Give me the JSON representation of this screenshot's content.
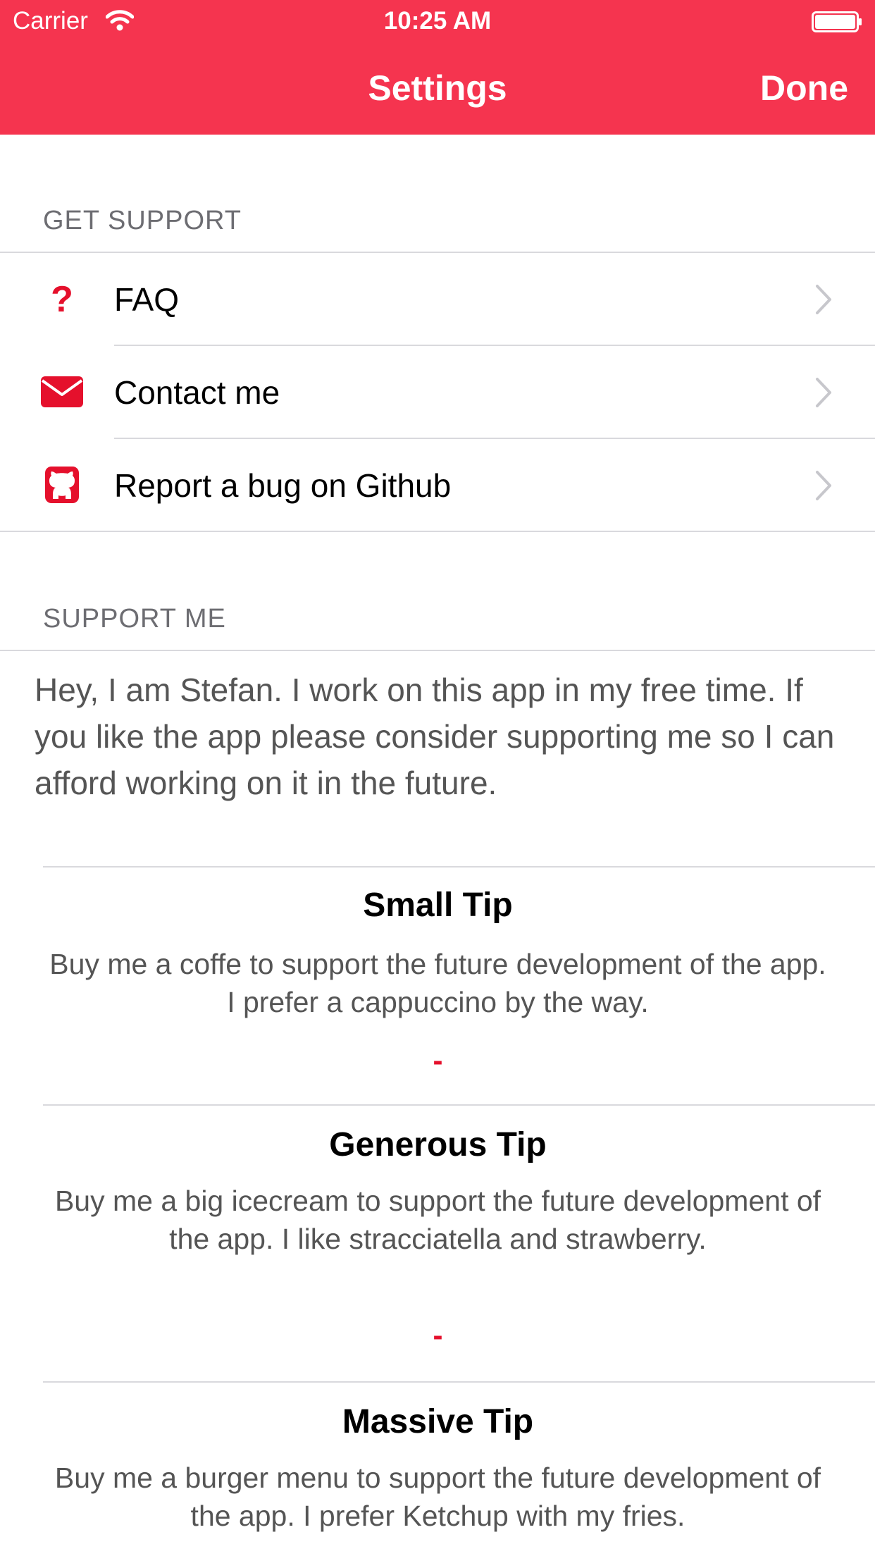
{
  "status_bar": {
    "carrier": "Carrier",
    "time": "10:25 AM"
  },
  "navbar": {
    "title": "Settings",
    "done_label": "Done"
  },
  "colors": {
    "accent": "#F5344F",
    "icon_red": "#E5102C"
  },
  "get_support": {
    "header": "GET SUPPORT",
    "items": [
      {
        "label": "FAQ",
        "icon": "question-mark-icon"
      },
      {
        "label": "Contact me",
        "icon": "envelope-icon"
      },
      {
        "label": "Report a bug on Github",
        "icon": "github-icon"
      }
    ]
  },
  "support_me": {
    "header": "SUPPORT ME",
    "text": "Hey, I am Stefan. I work on this app in my free time. If you like the app please consider supporting me so I can afford working on it in the future.",
    "tips": [
      {
        "title": "Small Tip",
        "description": "Buy me a coffe to support the future development of the app. I prefer a cappuccino by the way.",
        "price": "-"
      },
      {
        "title": "Generous Tip",
        "description": "Buy me a big icecream to support the future development of the app. I like stracciatella and strawberry.",
        "price": "-"
      },
      {
        "title": "Massive Tip",
        "description": "Buy me a burger menu to support the future development of the app. I prefer Ketchup with my fries."
      }
    ]
  }
}
